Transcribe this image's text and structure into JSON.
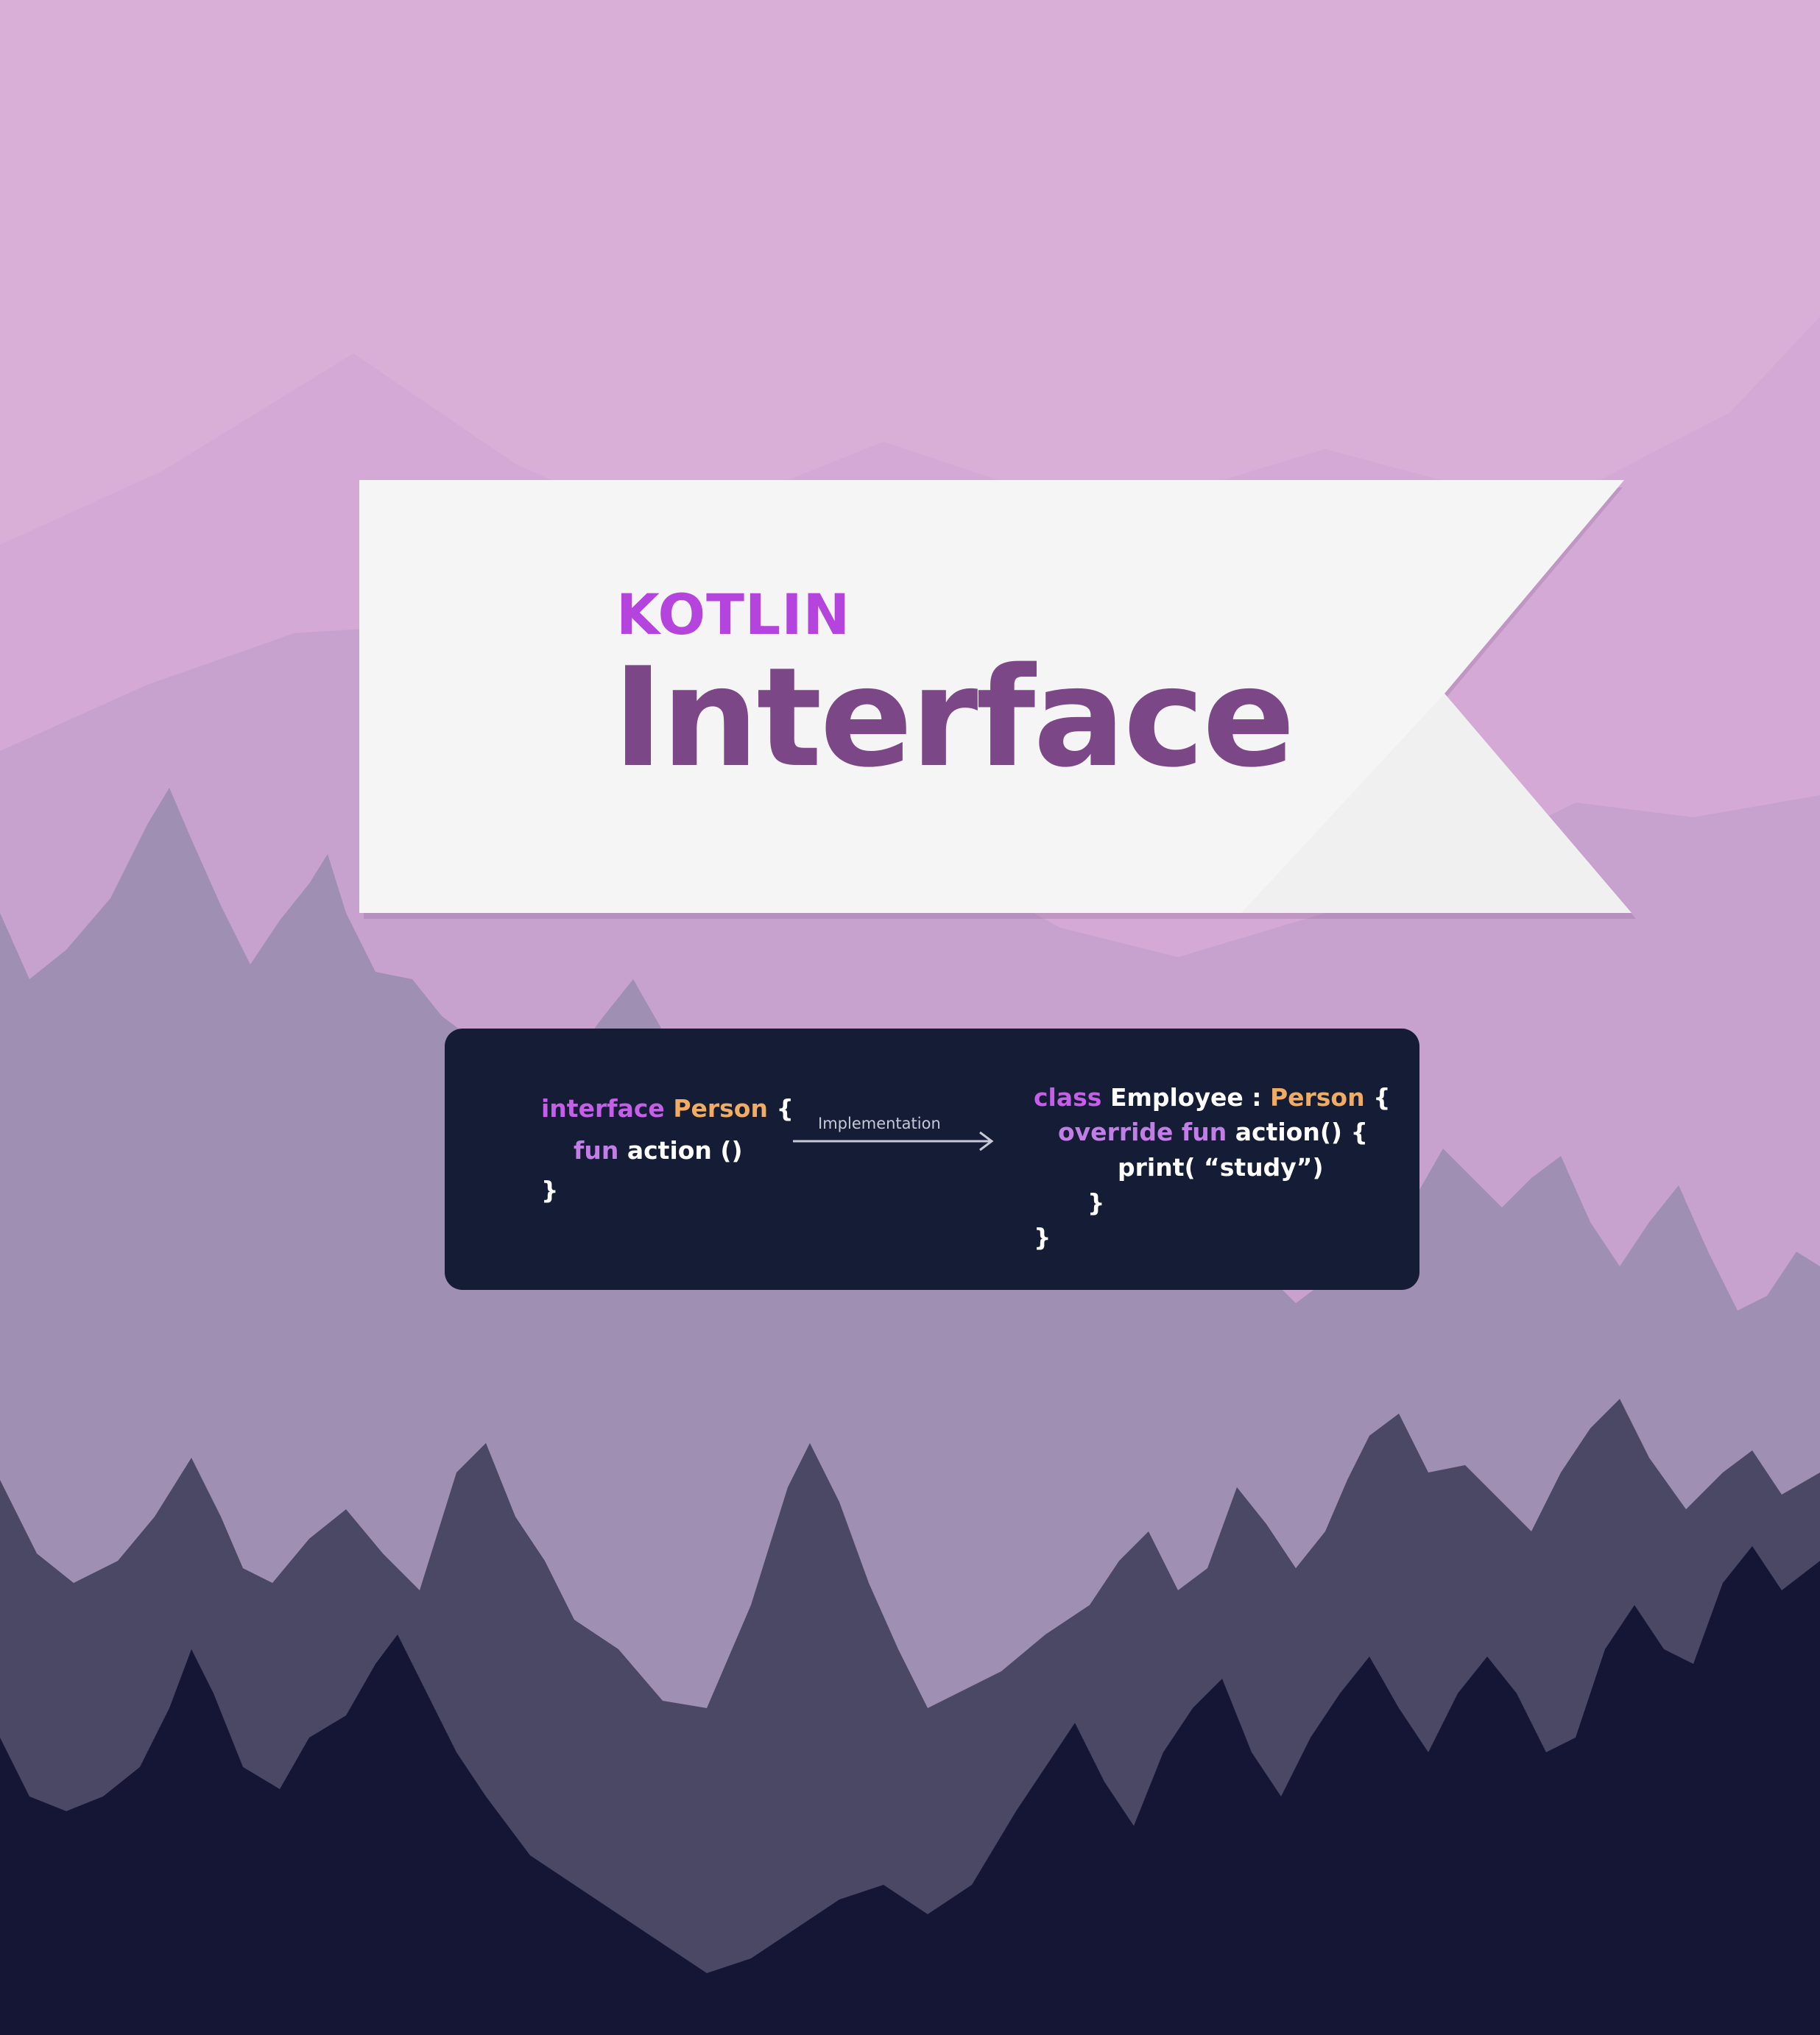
{
  "colors": {
    "sky": "#d9aed7",
    "mountains_far": "#d4a9d5",
    "mountains_near": "#c8a2cf",
    "trees_far": "#9f8fb2",
    "trees_mid": "#4a4864",
    "trees_near": "#151635",
    "banner": "#f5f5f5",
    "kicker": "#b543de",
    "headline": "#7b4786",
    "code_background": "#141d35",
    "code_keyword": "#c27de6",
    "code_type": "#f2ab62",
    "code_text": "#ffffff"
  },
  "banner": {
    "kicker": "KOTLIN",
    "headline": "Interface"
  },
  "code": {
    "left": {
      "line1": {
        "keyword": "interface",
        "type": "Person",
        "brace": "{"
      },
      "line2": {
        "keyword": "fun",
        "text": "action ()"
      },
      "line3": {
        "text": "}"
      }
    },
    "arrow": {
      "label": "Implementation",
      "icon": "right-arrow-icon"
    },
    "right": {
      "line1": {
        "keyword": "class",
        "text": "Employee :",
        "type": "Person",
        "brace": "{"
      },
      "line2": {
        "keyword": "override fun",
        "text": "action() {"
      },
      "line3": {
        "text": "print( “study”)"
      },
      "line4": {
        "text": "}"
      },
      "line5": {
        "text": "}"
      }
    }
  }
}
